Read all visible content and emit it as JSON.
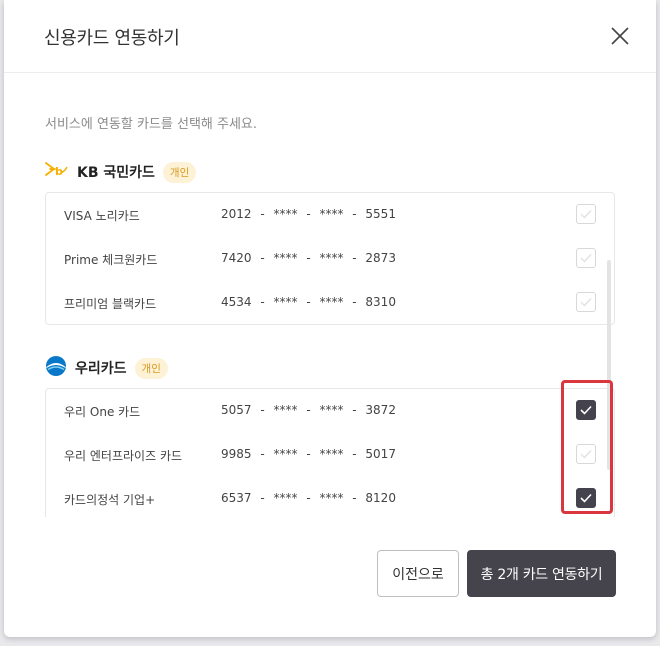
{
  "modal": {
    "title": "신용카드 연동하기",
    "description": "서비스에 연동할 카드를 선택해 주세요."
  },
  "banks": [
    {
      "name": "KB 국민카드",
      "badge": "개인",
      "logo_icon": "kb-star-logo-icon",
      "cards": [
        {
          "name": "VISA 노리카드",
          "number": "2012 - **** - **** - 5551",
          "checked": false
        },
        {
          "name": "Prime 체크원카드",
          "number": "7420 - **** - **** - 2873",
          "checked": false
        },
        {
          "name": "프리미엄 블랙카드",
          "number": "4534 - **** - **** - 8310",
          "checked": false
        }
      ]
    },
    {
      "name": "우리카드",
      "badge": "개인",
      "logo_icon": "woori-logo-icon",
      "cards": [
        {
          "name": "우리 One 카드",
          "number": "5057 - **** - **** - 3872",
          "checked": true
        },
        {
          "name": "우리 엔터프라이즈 카드",
          "number": "9985 - **** - **** - 5017",
          "checked": false
        },
        {
          "name": "카드의정석 기업+",
          "number": "6537 - **** - **** - 8120",
          "checked": true
        }
      ]
    }
  ],
  "buttons": {
    "prev_label": "이전으로",
    "connect_label": "총 2개 카드 연동하기"
  },
  "colors": {
    "primary": "#45434b",
    "badge_text": "#d99a1e",
    "badge_bg": "#fdf1d6",
    "highlight": "#d9363e"
  }
}
